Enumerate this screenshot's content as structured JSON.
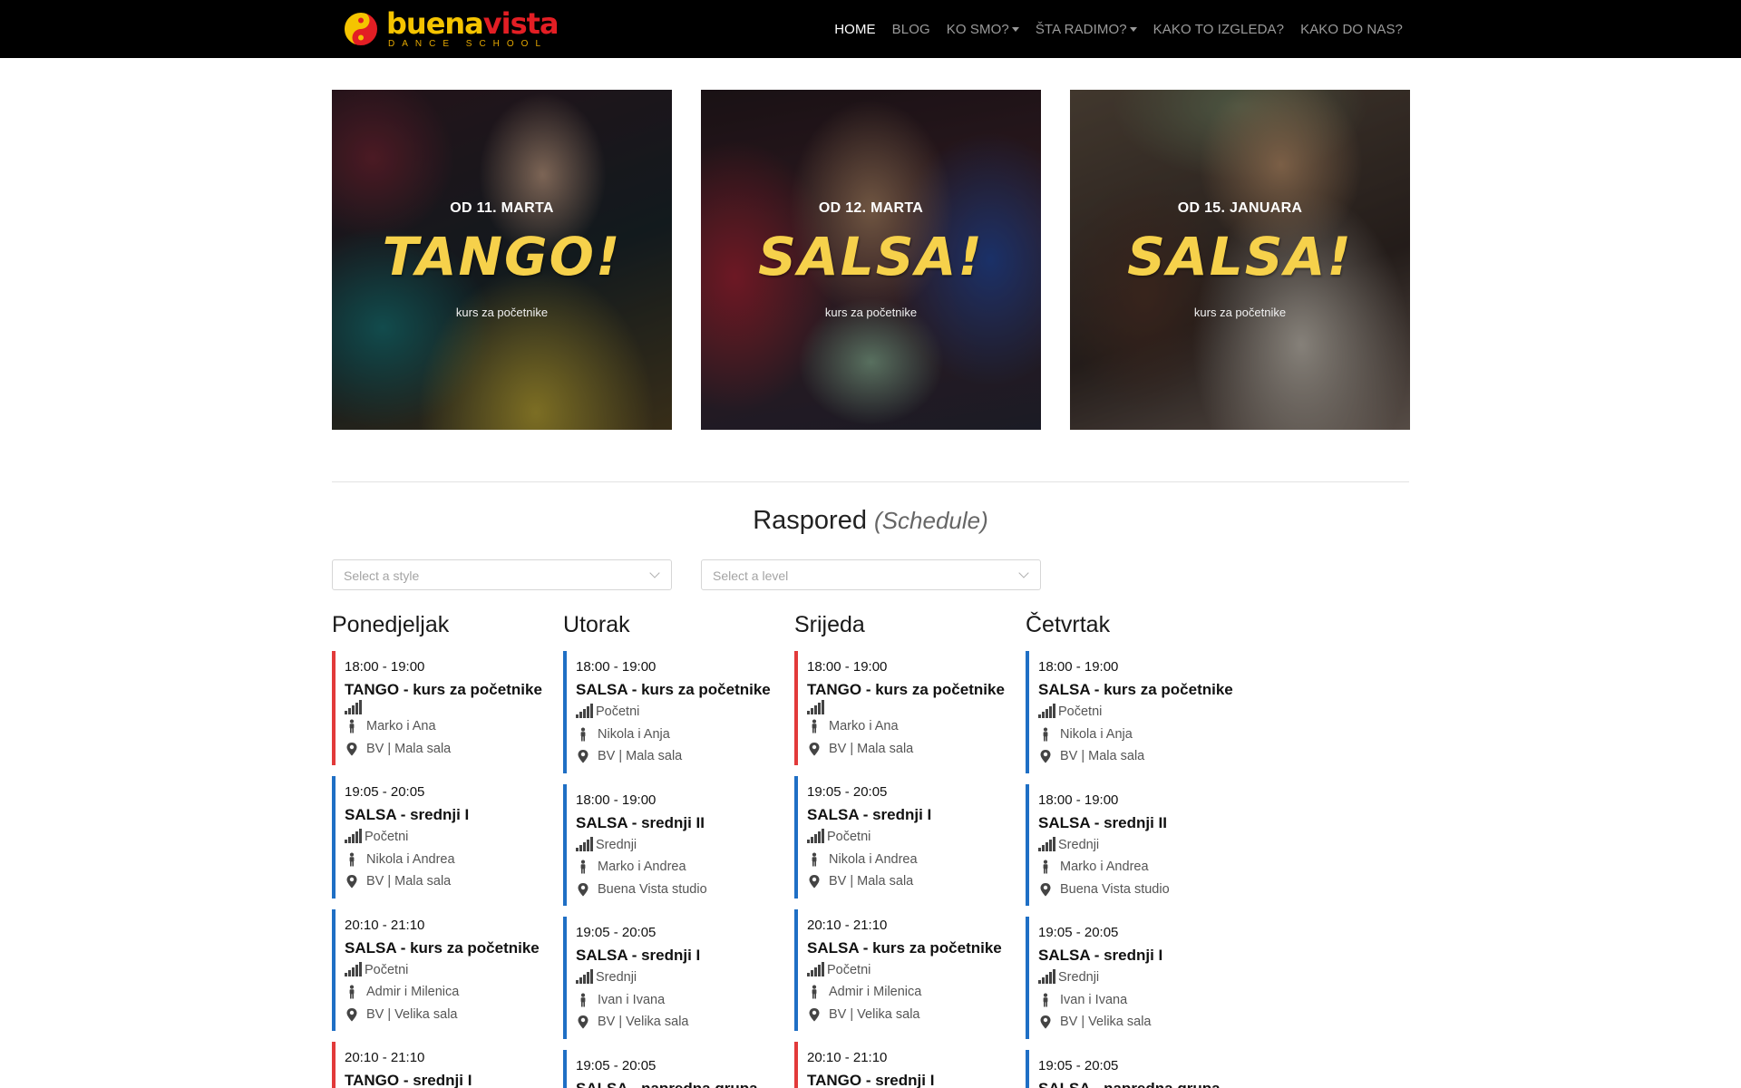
{
  "brand": {
    "name_part1": "buena",
    "name_part2": "vista",
    "tagline": "DANCE SCHOOL",
    "colors": {
      "yellow": "#f5c400",
      "red": "#e31e24"
    }
  },
  "nav": {
    "items": [
      {
        "label": "HOME",
        "active": true,
        "dropdown": false
      },
      {
        "label": "BLOG",
        "active": false,
        "dropdown": false
      },
      {
        "label": "KO SMO?",
        "active": false,
        "dropdown": true
      },
      {
        "label": "ŠTA RADIMO?",
        "active": false,
        "dropdown": true
      },
      {
        "label": "KAKO TO IZGLEDA?",
        "active": false,
        "dropdown": false
      },
      {
        "label": "KAKO DO NAS?",
        "active": false,
        "dropdown": false
      }
    ]
  },
  "promos": [
    {
      "date": "OD 11. MARTA",
      "title": "TANGO!",
      "subtitle": "kurs za početnike"
    },
    {
      "date": "OD 12. MARTA",
      "title": "SALSA!",
      "subtitle": "kurs za početnike"
    },
    {
      "date": "OD 15. JANUARA",
      "title": "SALSA!",
      "subtitle": "kurs za početnike"
    }
  ],
  "schedule": {
    "title": "Raspored",
    "title_en": "(Schedule)",
    "filters": {
      "style_placeholder": "Select a style",
      "level_placeholder": "Select a level"
    },
    "style_colors": {
      "salsa": "#1f6fc5",
      "tango": "#e23a3a"
    },
    "days": [
      {
        "name": "Ponedjeljak",
        "classes": [
          {
            "style": "tango",
            "time": "18:00 - 19:00",
            "name": "TANGO - kurs za početnike",
            "level": "",
            "instructors": "Marko i Ana",
            "location": "BV | Mala sala"
          },
          {
            "style": "salsa",
            "time": "19:05 - 20:05",
            "name": "SALSA - srednji I",
            "level": "Početni",
            "instructors": "Nikola i Andrea",
            "location": "BV | Mala sala"
          },
          {
            "style": "salsa",
            "time": "20:10 - 21:10",
            "name": "SALSA - kurs za početnike",
            "level": "Početni",
            "instructors": "Admir i Milenica",
            "location": "BV | Velika sala"
          },
          {
            "style": "tango",
            "time": "20:10 - 21:10",
            "name": "TANGO - srednji I",
            "level": "",
            "instructors": "",
            "location": ""
          }
        ]
      },
      {
        "name": "Utorak",
        "classes": [
          {
            "style": "salsa",
            "time": "18:00 - 19:00",
            "name": "SALSA - kurs za početnike",
            "level": "Početni",
            "instructors": "Nikola i Anja",
            "location": "BV | Mala sala"
          },
          {
            "style": "salsa",
            "time": "18:00 - 19:00",
            "name": "SALSA - srednji II",
            "level": "Srednji",
            "instructors": "Marko i Andrea",
            "location": "Buena Vista studio"
          },
          {
            "style": "salsa",
            "time": "19:05 - 20:05",
            "name": "SALSA - srednji I",
            "level": "Srednji",
            "instructors": "Ivan i Ivana",
            "location": "BV | Velika sala"
          },
          {
            "style": "salsa",
            "time": "19:05 - 20:05",
            "name": "SALSA - napredna grupa",
            "level": "",
            "instructors": "",
            "location": ""
          }
        ]
      },
      {
        "name": "Srijeda",
        "classes": [
          {
            "style": "tango",
            "time": "18:00 - 19:00",
            "name": "TANGO - kurs za početnike",
            "level": "",
            "instructors": "Marko i Ana",
            "location": "BV | Mala sala"
          },
          {
            "style": "salsa",
            "time": "19:05 - 20:05",
            "name": "SALSA - srednji I",
            "level": "Početni",
            "instructors": "Nikola i Andrea",
            "location": "BV | Mala sala"
          },
          {
            "style": "salsa",
            "time": "20:10 - 21:10",
            "name": "SALSA - kurs za početnike",
            "level": "Početni",
            "instructors": "Admir i Milenica",
            "location": "BV | Velika sala"
          },
          {
            "style": "tango",
            "time": "20:10 - 21:10",
            "name": "TANGO - srednji I",
            "level": "",
            "instructors": "",
            "location": ""
          }
        ]
      },
      {
        "name": "Četvrtak",
        "classes": [
          {
            "style": "salsa",
            "time": "18:00 - 19:00",
            "name": "SALSA - kurs za početnike",
            "level": "Početni",
            "instructors": "Nikola i Anja",
            "location": "BV | Mala sala"
          },
          {
            "style": "salsa",
            "time": "18:00 - 19:00",
            "name": "SALSA - srednji II",
            "level": "Srednji",
            "instructors": "Marko i Andrea",
            "location": "Buena Vista studio"
          },
          {
            "style": "salsa",
            "time": "19:05 - 20:05",
            "name": "SALSA - srednji I",
            "level": "Srednji",
            "instructors": "Ivan i Ivana",
            "location": "BV | Velika sala"
          },
          {
            "style": "salsa",
            "time": "19:05 - 20:05",
            "name": "SALSA - napredna grupa",
            "level": "",
            "instructors": "",
            "location": ""
          }
        ]
      }
    ]
  }
}
